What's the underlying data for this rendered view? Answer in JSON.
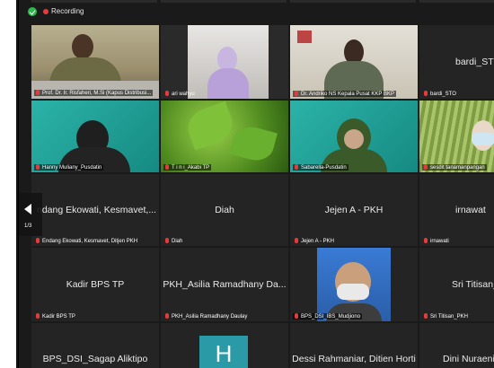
{
  "topbar": {
    "recording_label": "Recording"
  },
  "tiles": [
    {
      "id": "t1",
      "tag": "Prof. Dr. Ir. Risfaheri, M.Si (Kapus Distribusi..."
    },
    {
      "id": "t2",
      "tag": "ari wahyu"
    },
    {
      "id": "t3",
      "tag": "Dr. Andriko NS Kepala Pusat KKP BKP"
    },
    {
      "id": "t4",
      "name": "bardi_ST",
      "tag": "bardi_STO"
    },
    {
      "id": "t5",
      "tag": "Hanny Muliany_Pusdatin"
    },
    {
      "id": "t6",
      "tag": "T i n i_Akabi TP"
    },
    {
      "id": "t7",
      "tag": "Sabarella-Pusdatin"
    },
    {
      "id": "t8",
      "tag": "sesdit tanamanpangan"
    },
    {
      "id": "t9",
      "name": "ndang Ekowati, Kesmavet,...",
      "tag": "Endang Ekowati, Kesmavet, Ditjen PKH"
    },
    {
      "id": "t10",
      "name": "Diah",
      "tag": "Diah"
    },
    {
      "id": "t11",
      "name": "Jejen A - PKH",
      "tag": "Jejen A - PKH"
    },
    {
      "id": "t12",
      "name": "irnawat",
      "tag": "irnawati"
    },
    {
      "id": "t13",
      "name": "Kadir BPS TP",
      "tag": "Kadir BPS TP"
    },
    {
      "id": "t14",
      "name": "PKH_Asilia Ramadhany Da...",
      "tag": "PKH_Asilia Ramadhany Daulay"
    },
    {
      "id": "t15",
      "tag": "BPS_DSI_IBS_Mudjiono"
    },
    {
      "id": "t16",
      "name": "Sri Titisan_",
      "tag": "Sri Titisan_PKH"
    },
    {
      "id": "t17",
      "name": "BPS_DSI_Sagap Aliktipo"
    },
    {
      "id": "t18",
      "letter": "H"
    },
    {
      "id": "t19",
      "name": "Dessi Rahmaniar, Ditien Horti"
    },
    {
      "id": "t20",
      "name": "Dini Nuraeni_P"
    }
  ],
  "pager": {
    "page": "1/3"
  },
  "colors": {
    "bg": "#1a1a1a",
    "tile": "#242424",
    "active_border": "#c9d94a",
    "recording": "#e43c3c",
    "shield": "#2db84a"
  }
}
